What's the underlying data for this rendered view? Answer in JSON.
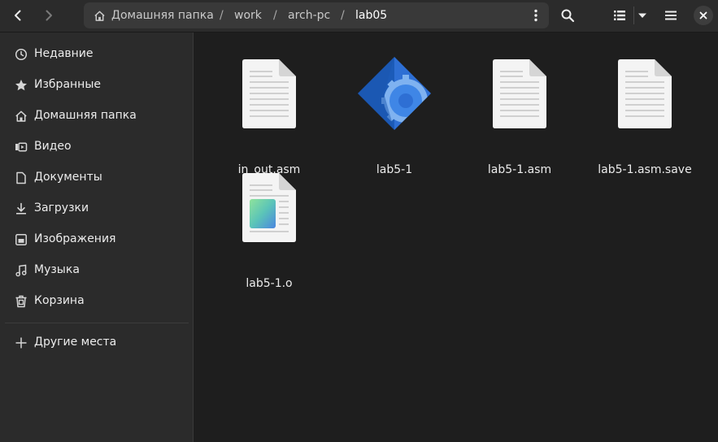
{
  "window": {
    "breadcrumb": {
      "home_label": "Домашняя папка",
      "segments": [
        "work",
        "arch-pc",
        "lab05"
      ],
      "separator": "/"
    }
  },
  "icons": {
    "back": "go-previous-icon",
    "forward": "go-next-icon",
    "home": "home-icon",
    "menu": "vertical-dots-icon",
    "search": "search-icon",
    "view": "list-view-icon",
    "view_options": "chevron-down-icon",
    "main_menu": "hamburger-icon",
    "close": "close-icon"
  },
  "sidebar": {
    "items": [
      {
        "label": "Недавние",
        "icon": "clock-icon"
      },
      {
        "label": "Избранные",
        "icon": "star-icon"
      },
      {
        "label": "Домашняя папка",
        "icon": "home-icon"
      },
      {
        "label": "Видео",
        "icon": "video-icon"
      },
      {
        "label": "Документы",
        "icon": "document-icon"
      },
      {
        "label": "Загрузки",
        "icon": "download-icon"
      },
      {
        "label": "Изображения",
        "icon": "image-icon"
      },
      {
        "label": "Музыка",
        "icon": "music-icon"
      },
      {
        "label": "Корзина",
        "icon": "trash-icon"
      }
    ],
    "other_locations": {
      "label": "Другие места",
      "icon": "plus-icon"
    }
  },
  "files": [
    {
      "name": "in_out.asm",
      "icon": "text-file-icon"
    },
    {
      "name": "lab5-1",
      "icon": "executable-file-icon"
    },
    {
      "name": "lab5-1.asm",
      "icon": "text-file-icon"
    },
    {
      "name": "lab5-1.asm.save",
      "icon": "text-file-icon"
    },
    {
      "name": "lab5-1.o",
      "icon": "object-file-icon"
    }
  ],
  "colors": {
    "accent": "#3584e4",
    "headerbar": "#2b2b2b",
    "content_bg": "#1e1e1e"
  }
}
